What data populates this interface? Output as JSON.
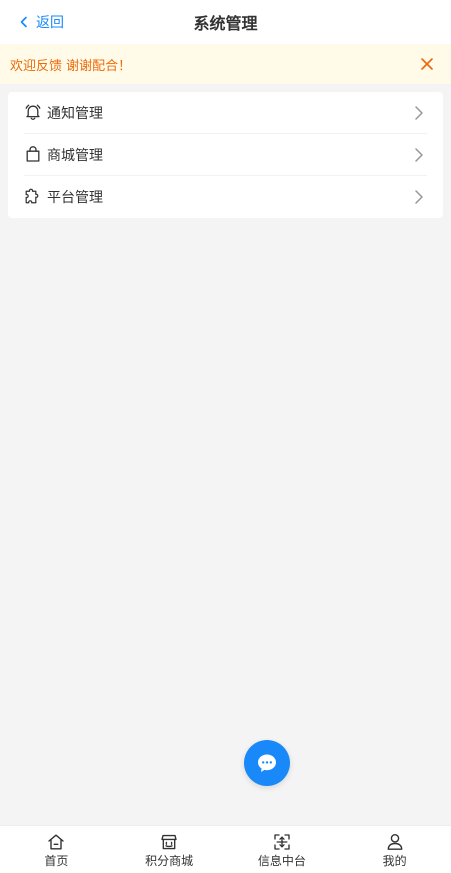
{
  "header": {
    "back_label": "返回",
    "title": "系统管理"
  },
  "notice": {
    "text": "欢迎反馈 谢谢配合！"
  },
  "menu": {
    "items": [
      {
        "label": "通知管理",
        "icon": "bell-icon"
      },
      {
        "label": "商城管理",
        "icon": "shopping-bag-icon"
      },
      {
        "label": "平台管理",
        "icon": "puzzle-icon"
      }
    ]
  },
  "tabbar": {
    "items": [
      {
        "label": "首页",
        "icon": "home-icon"
      },
      {
        "label": "积分商城",
        "icon": "shop-icon"
      },
      {
        "label": "信息中台",
        "icon": "scan-icon"
      },
      {
        "label": "我的",
        "icon": "user-icon"
      }
    ]
  },
  "colors": {
    "primary": "#1989fa",
    "notice_bg": "#fffbe8",
    "notice_text": "#ed6a0c",
    "page_bg": "#f4f4f4"
  }
}
